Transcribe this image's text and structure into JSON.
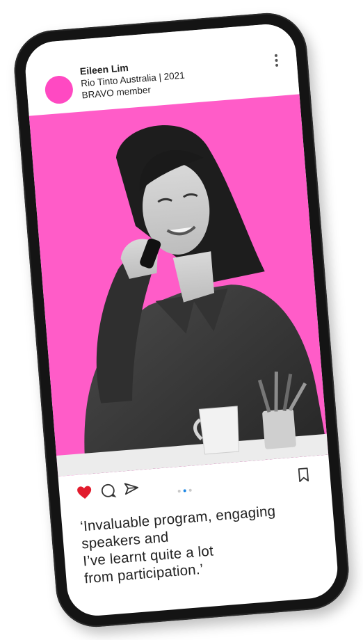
{
  "post": {
    "author_name": "Eileen Lim",
    "author_company": "Rio Tinto Australia | 2021",
    "author_role": "BRAVO member",
    "caption_lines": [
      "‘Invaluable program, engaging",
      "speakers and",
      "I’ve learnt quite a lot",
      "from participation.’"
    ],
    "liked": true,
    "carousel": {
      "count": 3,
      "active_index": 1
    }
  },
  "icons": {
    "avatar": "avatar-circle",
    "more": "vertical-ellipsis-icon",
    "like": "heart-icon",
    "comment": "comment-icon",
    "share": "send-icon",
    "save": "bookmark-icon"
  },
  "colors": {
    "brand_pink": "#ff5cc8",
    "avatar_pink": "#ff49c2",
    "heart_red": "#e21b2d",
    "dot_active": "#1e88e5",
    "phone_frame": "#141414"
  }
}
